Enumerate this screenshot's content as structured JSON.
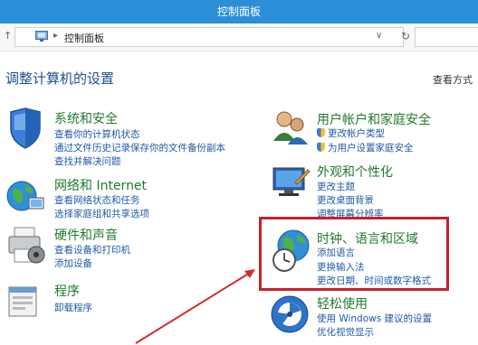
{
  "window": {
    "title": "控制面板"
  },
  "address": {
    "crumb": "控制面板",
    "nav_up": "↑",
    "refresh": "↻",
    "dropdown": "∨"
  },
  "header": {
    "title": "调整计算机的设置",
    "view_by": "查看方式"
  },
  "categories": {
    "system": {
      "title": "系统和安全",
      "links": [
        "查看你的计算机状态",
        "通过文件历史记录保存你的文件备份副本",
        "查找并解决问题"
      ]
    },
    "network": {
      "title": "网络和 Internet",
      "links": [
        "查看网络状态和任务",
        "选择家庭组和共享选项"
      ]
    },
    "hardware": {
      "title": "硬件和声音",
      "links": [
        "查看设备和打印机",
        "添加设备"
      ]
    },
    "programs": {
      "title": "程序",
      "links": [
        "卸载程序"
      ]
    },
    "users": {
      "title": "用户帐户和家庭安全",
      "links": [
        "更改帐户类型",
        "为用户设置家庭安全"
      ]
    },
    "appearance": {
      "title": "外观和个性化",
      "links": [
        "更改主题",
        "更改桌面背景",
        "调整屏幕分辨率"
      ]
    },
    "clock": {
      "title": "时钟、语言和区域",
      "links": [
        "添加语言",
        "更换输入法",
        "更改日期、时间或数字格式"
      ]
    },
    "ease": {
      "title": "轻松使用",
      "links": [
        "使用 Windows 建议的设置",
        "优化视觉显示"
      ]
    }
  },
  "colors": {
    "title_bar": "#2a8fd6",
    "category_title": "#1f7a2e",
    "link": "#1e5aa8",
    "highlight": "#c8202b",
    "heading": "#1d4f91"
  }
}
